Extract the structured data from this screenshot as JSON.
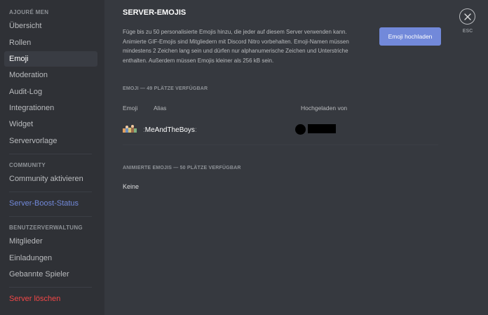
{
  "sidebar": {
    "section_server": "AJOURÉ MEN",
    "items_server": [
      "Übersicht",
      "Rollen",
      "Emoji",
      "Moderation",
      "Audit-Log",
      "Integrationen",
      "Widget",
      "Servervorlage"
    ],
    "section_community": "COMMUNITY",
    "community_item": "Community aktivieren",
    "boost_item": "Server-Boost-Status",
    "section_users": "BENUTZERVERWALTUNG",
    "items_users": [
      "Mitglieder",
      "Einladungen",
      "Gebannte Spieler"
    ],
    "delete_item": "Server löschen",
    "selected": "Emoji"
  },
  "main": {
    "title": "SERVER-EMOJIS",
    "description": "Füge bis zu 50 personalisierte Emojis hinzu, die jeder auf diesem Server verwenden kann. Animierte GIF-Emojis sind Mitgliedern mit Discord Nitro vorbehalten. Emoji-Namen müssen mindestens 2 Zeichen lang sein und dürfen nur alphanumerische Zeichen und Unterstriche enthalten. Außerdem müssen Emojis kleiner als 256 kB sein.",
    "upload_button": "Emoji hochladen",
    "emoji_section": "EMOJI — 49 PLÄTZE VERFÜGBAR",
    "col_emoji": "Emoji",
    "col_alias": "Alias",
    "col_uploader": "Hochgeladen von",
    "emojis": [
      {
        "alias": "MeAndTheBoys",
        "icon": "custom-emoji-image",
        "uploader": "redacted"
      }
    ],
    "animated_section": "ANIMIERTE EMOJIS — 50 PLÄTZE VERFÜGBAR",
    "animated_none": "Keine"
  },
  "close": {
    "icon": "close-icon",
    "label": "ESC"
  },
  "colors": {
    "background": "#36393f",
    "sidebar": "#2f3136",
    "accent": "#7289da",
    "danger": "#f04747"
  }
}
